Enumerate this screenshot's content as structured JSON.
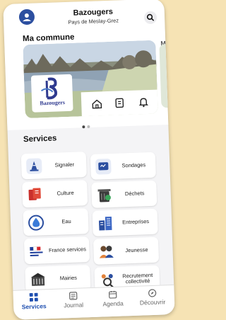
{
  "header": {
    "town_name": "Bazougers",
    "subtitle": "Pays de Meslay-Grez"
  },
  "ma_commune": {
    "title": "Ma commune",
    "crest_word": "Bazougers",
    "peek_label": "M",
    "icons": [
      "home-icon",
      "document-icon",
      "bell-icon"
    ]
  },
  "carousel": {
    "pages": 2,
    "active_index": 0
  },
  "services": {
    "title": "Services",
    "items": [
      {
        "label": "Signaler",
        "icon": "signal-cone-icon"
      },
      {
        "label": "Sondages",
        "icon": "survey-icon"
      },
      {
        "label": "Culture",
        "icon": "books-icon"
      },
      {
        "label": "Déchets",
        "icon": "trash-bin-icon"
      },
      {
        "label": "Eau",
        "icon": "water-icon"
      },
      {
        "label": "Entreprises",
        "icon": "buildings-icon"
      },
      {
        "label": "France services",
        "icon": "france-services-icon"
      },
      {
        "label": "Jeunesse",
        "icon": "youth-icon"
      },
      {
        "label": "Mairies",
        "icon": "town-hall-icon"
      },
      {
        "label": "Recrutement collectivité",
        "icon": "recruitment-icon"
      }
    ]
  },
  "tabbar": {
    "items": [
      {
        "label": "Services",
        "active": true
      },
      {
        "label": "Journal",
        "active": false
      },
      {
        "label": "Agenda",
        "active": false
      },
      {
        "label": "Découvrir",
        "active": false
      }
    ]
  },
  "colors": {
    "accent": "#1f4fb0",
    "background": "#f6e3b4",
    "screen": "#f4f4f6"
  }
}
